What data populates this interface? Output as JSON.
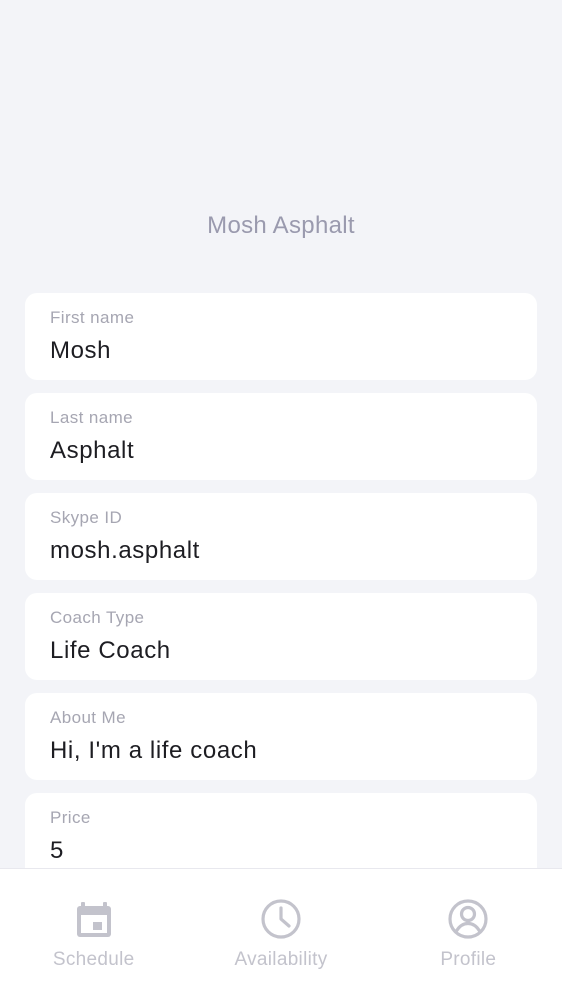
{
  "profile": {
    "display_name": "Mosh Asphalt"
  },
  "fields": [
    {
      "label": "First name",
      "value": "Mosh"
    },
    {
      "label": "Last name",
      "value": "Asphalt"
    },
    {
      "label": "Skype ID",
      "value": "mosh.asphalt"
    },
    {
      "label": "Coach Type",
      "value": "Life Coach"
    },
    {
      "label": "About Me",
      "value": "Hi, I'm a life coach"
    },
    {
      "label": "Price",
      "value": "5"
    }
  ],
  "bottom_nav": {
    "items": [
      {
        "label": "Schedule",
        "icon": "calendar-icon"
      },
      {
        "label": "Availability",
        "icon": "clock-icon"
      },
      {
        "label": "Profile",
        "icon": "user-circle-icon"
      }
    ]
  },
  "colors": {
    "background": "#f3f4f8",
    "card": "#ffffff",
    "nav_inactive": "#c3c3cc",
    "label_text": "#a6a6b2",
    "value_text": "#1d1d22",
    "name_text": "#9a9aae"
  }
}
